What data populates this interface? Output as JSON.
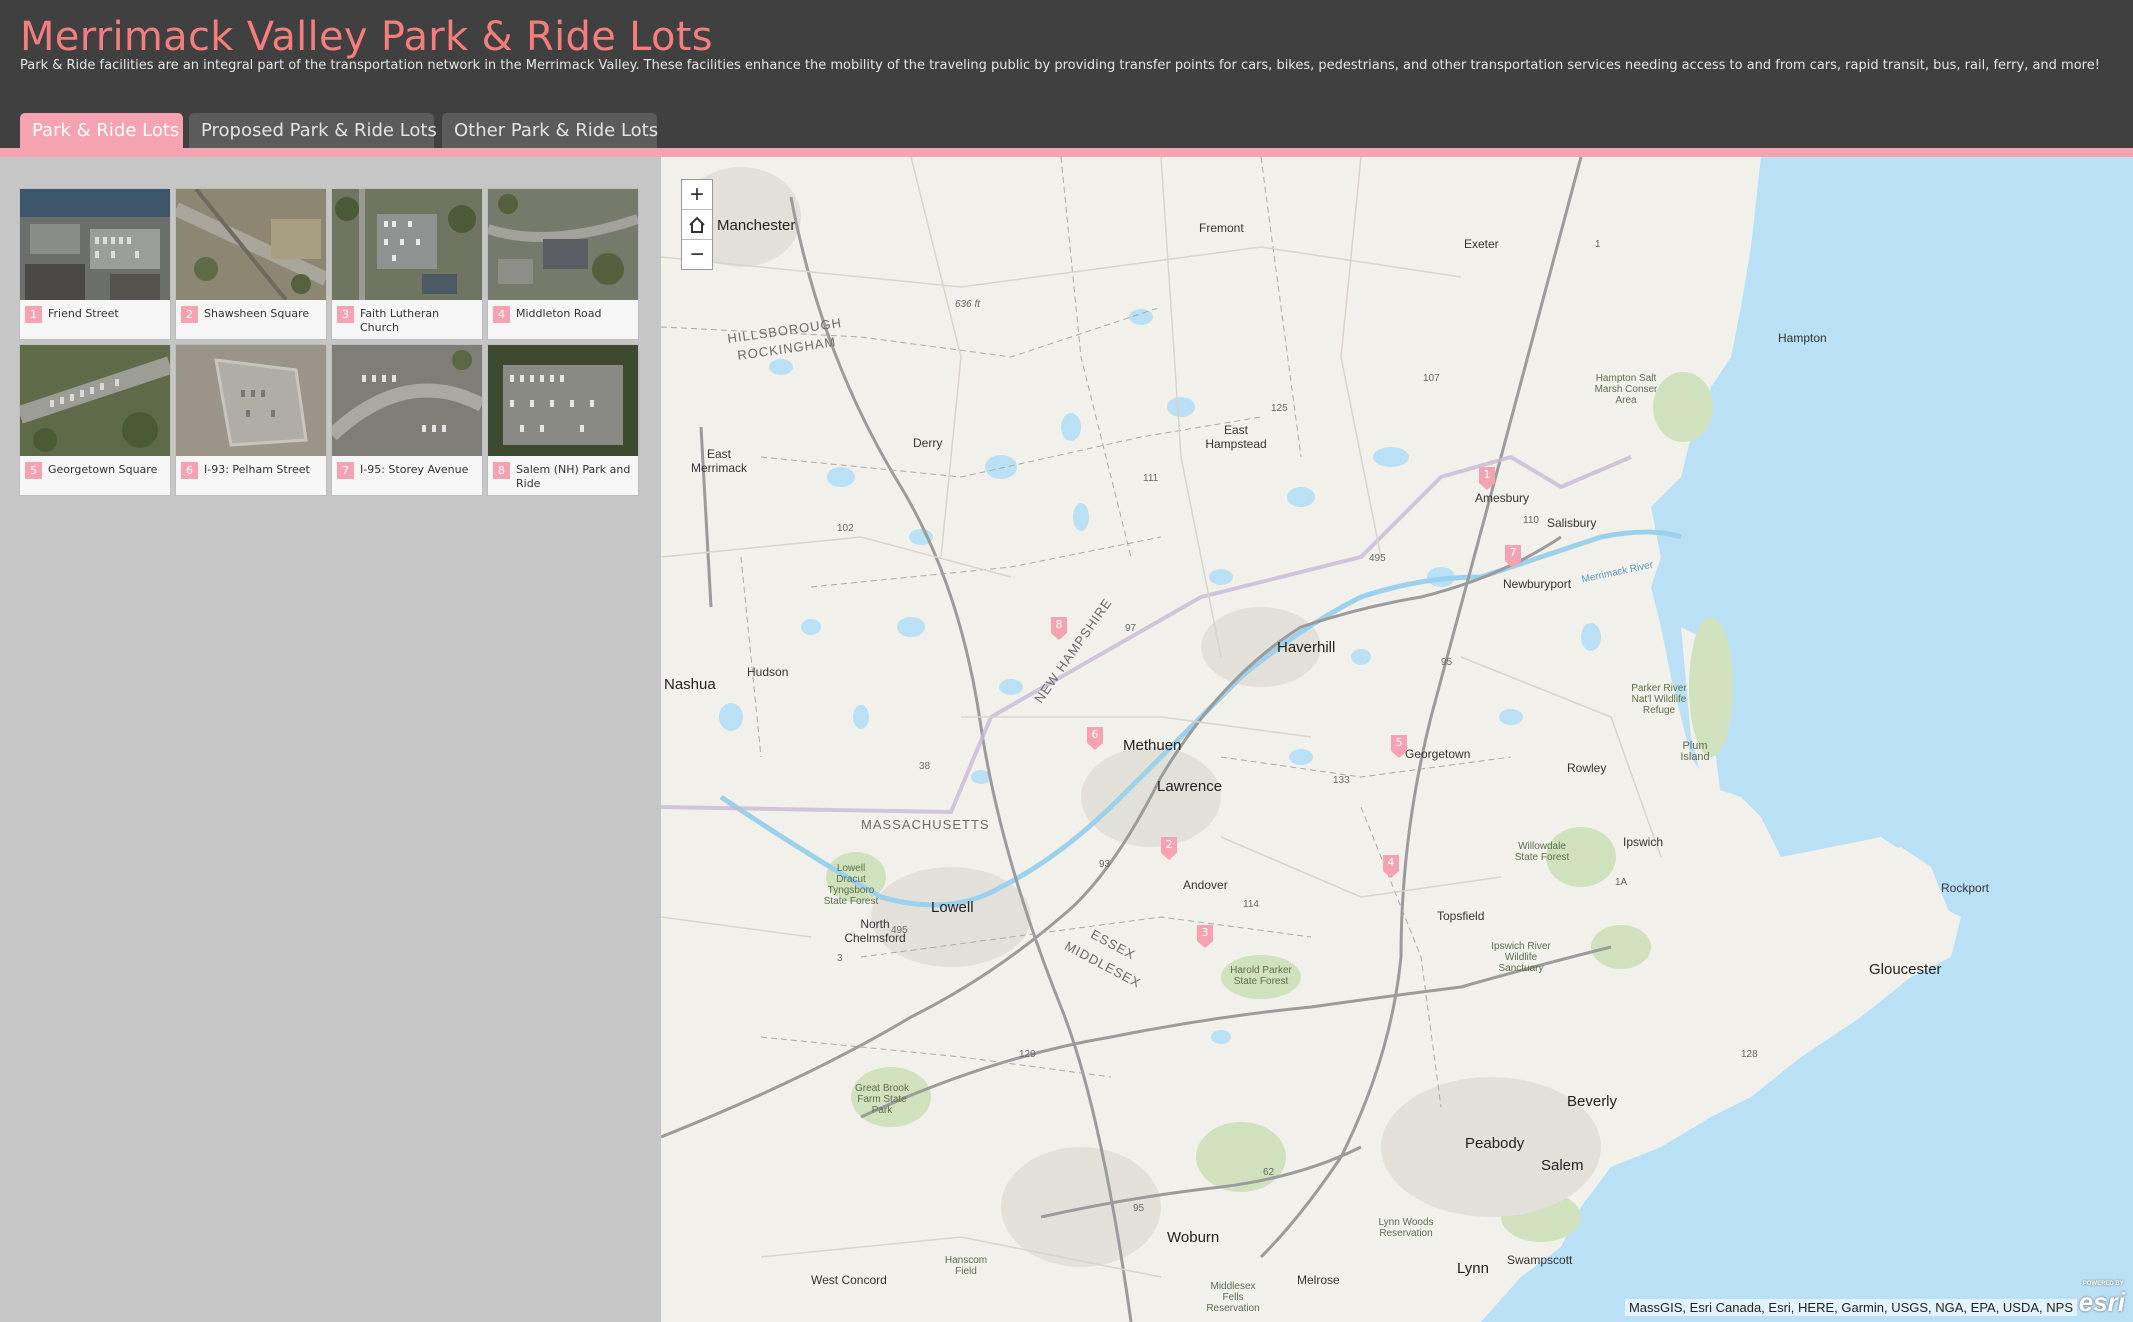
{
  "header": {
    "title": "Merrimack Valley Park & Ride Lots",
    "subtitle": "Park & Ride facilities are an integral part of the transportation network in the Merrimack Valley. These facilities enhance the mobility of the traveling public by providing transfer points for cars, bikes, pedestrians, and other transportation services needing access to and from cars, rapid transit, bus, rail, ferry, and more!"
  },
  "tabs": [
    {
      "label": "Park & Ride Lots",
      "active": true
    },
    {
      "label": "Proposed Park & Ride Lots",
      "active": false
    },
    {
      "label": "Other Park & Ride Lots",
      "active": false
    }
  ],
  "colors": {
    "accent": "#f5a3b0",
    "title": "#f47d7d",
    "header_bg": "#404040",
    "water": "#b9e0f4",
    "land": "#f2f0eb"
  },
  "lots": [
    {
      "num": "1",
      "name": "Friend Street"
    },
    {
      "num": "2",
      "name": "Shawsheen Square"
    },
    {
      "num": "3",
      "name": "Faith Lutheran Church"
    },
    {
      "num": "4",
      "name": "Middleton Road"
    },
    {
      "num": "5",
      "name": "Georgetown Square"
    },
    {
      "num": "6",
      "name": "I-93: Pelham Street"
    },
    {
      "num": "7",
      "name": "I-95: Storey Avenue"
    },
    {
      "num": "8",
      "name": "Salem (NH) Park and Ride"
    }
  ],
  "map": {
    "zoom": {
      "in": "+",
      "home_icon": "home-icon",
      "out": "−"
    },
    "attribution": "MassGIS, Esri Canada, Esri, HERE, Garmin, USGS, NGA, EPA, USDA, NPS",
    "logo": "esri",
    "logo_caption": "POWERED BY",
    "markers": [
      "1",
      "7",
      "8",
      "6",
      "5",
      "2",
      "4",
      "3"
    ],
    "labels": {
      "manchester": "Manchester",
      "fremont": "Fremont",
      "exeter": "Exeter",
      "hampton": "Hampton",
      "derry": "Derry",
      "east_hampstead": "East Hampstead",
      "east_merrimack": "East Merrimack",
      "amesbury": "Amesbury",
      "salisbury": "Salisbury",
      "newburyport": "Newburyport",
      "haverhill": "Haverhill",
      "nashua": "Nashua",
      "hudson": "Hudson",
      "methuen": "Methuen",
      "lawrence": "Lawrence",
      "georgetown": "Georgetown",
      "rowley": "Rowley",
      "andover": "Andover",
      "lowell": "Lowell",
      "north_chelmsford": "North Chelmsford",
      "topsfield": "Topsfield",
      "ipswich": "Ipswich",
      "rockport": "Rockport",
      "gloucester": "Gloucester",
      "beverly": "Beverly",
      "peabody": "Peabody",
      "salem": "Salem",
      "lynn": "Lynn",
      "swampscott": "Swampscott",
      "woburn": "Woburn",
      "melrose": "Melrose",
      "west_concord": "West Concord",
      "hillsborough": "HILLSBOROUGH",
      "rockingham": "ROCKINGHAM",
      "new_hampshire": "NEW HAMPSHIRE",
      "massachusetts": "MASSACHUSETTS",
      "essex": "ESSEX",
      "middlesex": "MIDDLESEX",
      "harold_parker": "Harold Parker State Forest",
      "willowdale": "Willowdale State Forest",
      "ipswich_river": "Ipswich River Wildlife Sanctuary",
      "parker_river": "Parker River Nat'l Wildlife Refuge",
      "plum_island": "Plum Island",
      "hampton_salt": "Hampton Salt Marsh Conser Area",
      "great_brook": "Great Brook Farm State Park",
      "lowell_dracut": "Lowell Dracut Tyngsboro State Forest",
      "lynn_woods": "Lynn Woods Reservation",
      "middlesex_fells": "Middlesex Fells Reservation",
      "hanscom": "Hanscom Field",
      "merrimack_river": "Merrimack River",
      "ft636": "636 ft",
      "i495": "495",
      "i93": "93",
      "i95": "95",
      "hw1": "1",
      "hw125": "125",
      "hw110": "110",
      "hw133": "133",
      "hw114": "114",
      "hw128": "128",
      "hw3": "3",
      "hw38": "38",
      "hw97": "97",
      "hw111": "111",
      "hw102": "102",
      "hw107": "107",
      "hw129": "129",
      "hw62": "62",
      "hw1a": "1A"
    }
  }
}
